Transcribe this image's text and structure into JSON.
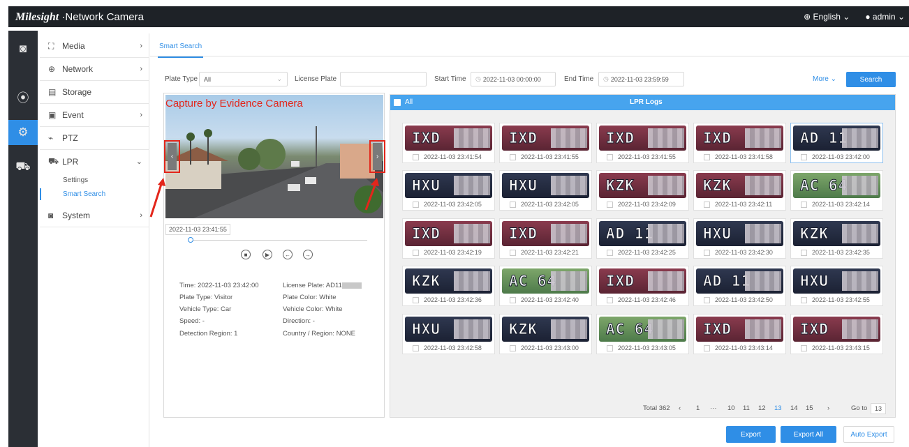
{
  "app": {
    "brand": "Milesight",
    "product": "Network Camera"
  },
  "topbar": {
    "language": "English",
    "user": "admin"
  },
  "iconbar": [
    {
      "name": "live-view-icon",
      "glyph": "◙"
    },
    {
      "name": "playback-icon",
      "glyph": "⦿"
    },
    {
      "name": "settings-icon",
      "glyph": "⚙"
    },
    {
      "name": "vehicle-icon",
      "glyph": "⛟"
    }
  ],
  "sidebar": {
    "items": [
      {
        "label": "Media",
        "icon": "media-icon",
        "glyph": "⛶",
        "expand": "›"
      },
      {
        "label": "Network",
        "icon": "globe-icon",
        "glyph": "⊕",
        "expand": "›"
      },
      {
        "label": "Storage",
        "icon": "storage-icon",
        "glyph": "▤",
        "expand": ""
      },
      {
        "label": "Event",
        "icon": "event-icon",
        "glyph": "▣",
        "expand": "›"
      },
      {
        "label": "PTZ",
        "icon": "ptz-icon",
        "glyph": "⌁",
        "expand": ""
      },
      {
        "label": "LPR",
        "icon": "car-icon",
        "glyph": "⛟",
        "expand": "⌄"
      },
      {
        "label": "System",
        "icon": "system-icon",
        "glyph": "◙",
        "expand": "›"
      }
    ],
    "lpr_sub": [
      "Settings",
      "Smart Search"
    ]
  },
  "tab": "Smart Search",
  "filters": {
    "plate_type_label": "Plate Type",
    "plate_type_value": "All",
    "license_plate_label": "License Plate",
    "license_plate_value": "",
    "start_time_label": "Start Time",
    "start_time_value": "2022-11-03 00:00:00",
    "end_time_label": "End Time",
    "end_time_value": "2022-11-03 23:59:59",
    "more": "More",
    "search": "Search"
  },
  "player": {
    "caption": "Capture by Evidence Camera",
    "timestamp": "2022-11-03 23:41:55",
    "controls": [
      "stop",
      "play",
      "prev",
      "next"
    ]
  },
  "details": {
    "time": "Time: 2022-11-03 23:42:00",
    "license_plate": "License Plate: AD11",
    "plate_type": "Plate Type: Visitor",
    "plate_color": "Plate Color: White",
    "vehicle_type": "Vehicle Type: Car",
    "vehicle_color": "Vehicle Color: White",
    "speed": "Speed: -",
    "direction": "Direction: -",
    "detection_region": "Detection Region: 1",
    "country_region": "Country / Region: NONE"
  },
  "logs": {
    "all_label": "All",
    "title": "LPR Logs",
    "cards": [
      {
        "plate": "IXD",
        "color": "red",
        "time": "2022-11-03 23:41:54"
      },
      {
        "plate": "IXD",
        "color": "red",
        "time": "2022-11-03 23:41:55"
      },
      {
        "plate": "IXD",
        "color": "red",
        "time": "2022-11-03 23:41:55"
      },
      {
        "plate": "IXD",
        "color": "red",
        "time": "2022-11-03 23:41:58"
      },
      {
        "plate": "AD 11",
        "color": "navy",
        "time": "2022-11-03 23:42:00"
      },
      {
        "plate": "HXU",
        "color": "navy",
        "time": "2022-11-03 23:42:05"
      },
      {
        "plate": "HXU",
        "color": "navy",
        "time": "2022-11-03 23:42:05"
      },
      {
        "plate": "KZK",
        "color": "red",
        "time": "2022-11-03 23:42:09"
      },
      {
        "plate": "KZK",
        "color": "red",
        "time": "2022-11-03 23:42:11"
      },
      {
        "plate": "AC 64",
        "color": "green",
        "time": "2022-11-03 23:42:14"
      },
      {
        "plate": "IXD",
        "color": "red",
        "time": "2022-11-03 23:42:19"
      },
      {
        "plate": "IXD",
        "color": "red",
        "time": "2022-11-03 23:42:21"
      },
      {
        "plate": "AD 11",
        "color": "navy",
        "time": "2022-11-03 23:42:25"
      },
      {
        "plate": "HXU",
        "color": "navy",
        "time": "2022-11-03 23:42:30"
      },
      {
        "plate": "KZK",
        "color": "navy",
        "time": "2022-11-03 23:42:35"
      },
      {
        "plate": "KZK",
        "color": "navy",
        "time": "2022-11-03 23:42:36"
      },
      {
        "plate": "AC 64",
        "color": "green",
        "time": "2022-11-03 23:42:40"
      },
      {
        "plate": "IXD",
        "color": "red",
        "time": "2022-11-03 23:42:46"
      },
      {
        "plate": "AD 11",
        "color": "navy",
        "time": "2022-11-03 23:42:50"
      },
      {
        "plate": "HXU",
        "color": "navy",
        "time": "2022-11-03 23:42:55"
      },
      {
        "plate": "HXU",
        "color": "navy",
        "time": "2022-11-03 23:42:58"
      },
      {
        "plate": "KZK",
        "color": "navy",
        "time": "2022-11-03 23:43:00"
      },
      {
        "plate": "AC 64",
        "color": "green",
        "time": "2022-11-03 23:43:05"
      },
      {
        "plate": "IXD",
        "color": "red",
        "time": "2022-11-03 23:43:14"
      },
      {
        "plate": "IXD",
        "color": "red",
        "time": "2022-11-03 23:43:15"
      }
    ],
    "selected_index": 4
  },
  "pagination": {
    "total": "Total 362",
    "prev": "‹",
    "pages": [
      "1",
      "···",
      "10",
      "11",
      "12",
      "13",
      "14",
      "15"
    ],
    "current": "13",
    "next": "›",
    "goto_label": "Go to",
    "goto_value": "13"
  },
  "actions": {
    "export": "Export",
    "export_all": "Export All",
    "auto_export": "Auto Export"
  },
  "colors": {
    "accent": "#2f8ee6",
    "topbar": "#1e2227",
    "iconbar": "#2b2f35",
    "annotation_red": "#e3261b"
  }
}
